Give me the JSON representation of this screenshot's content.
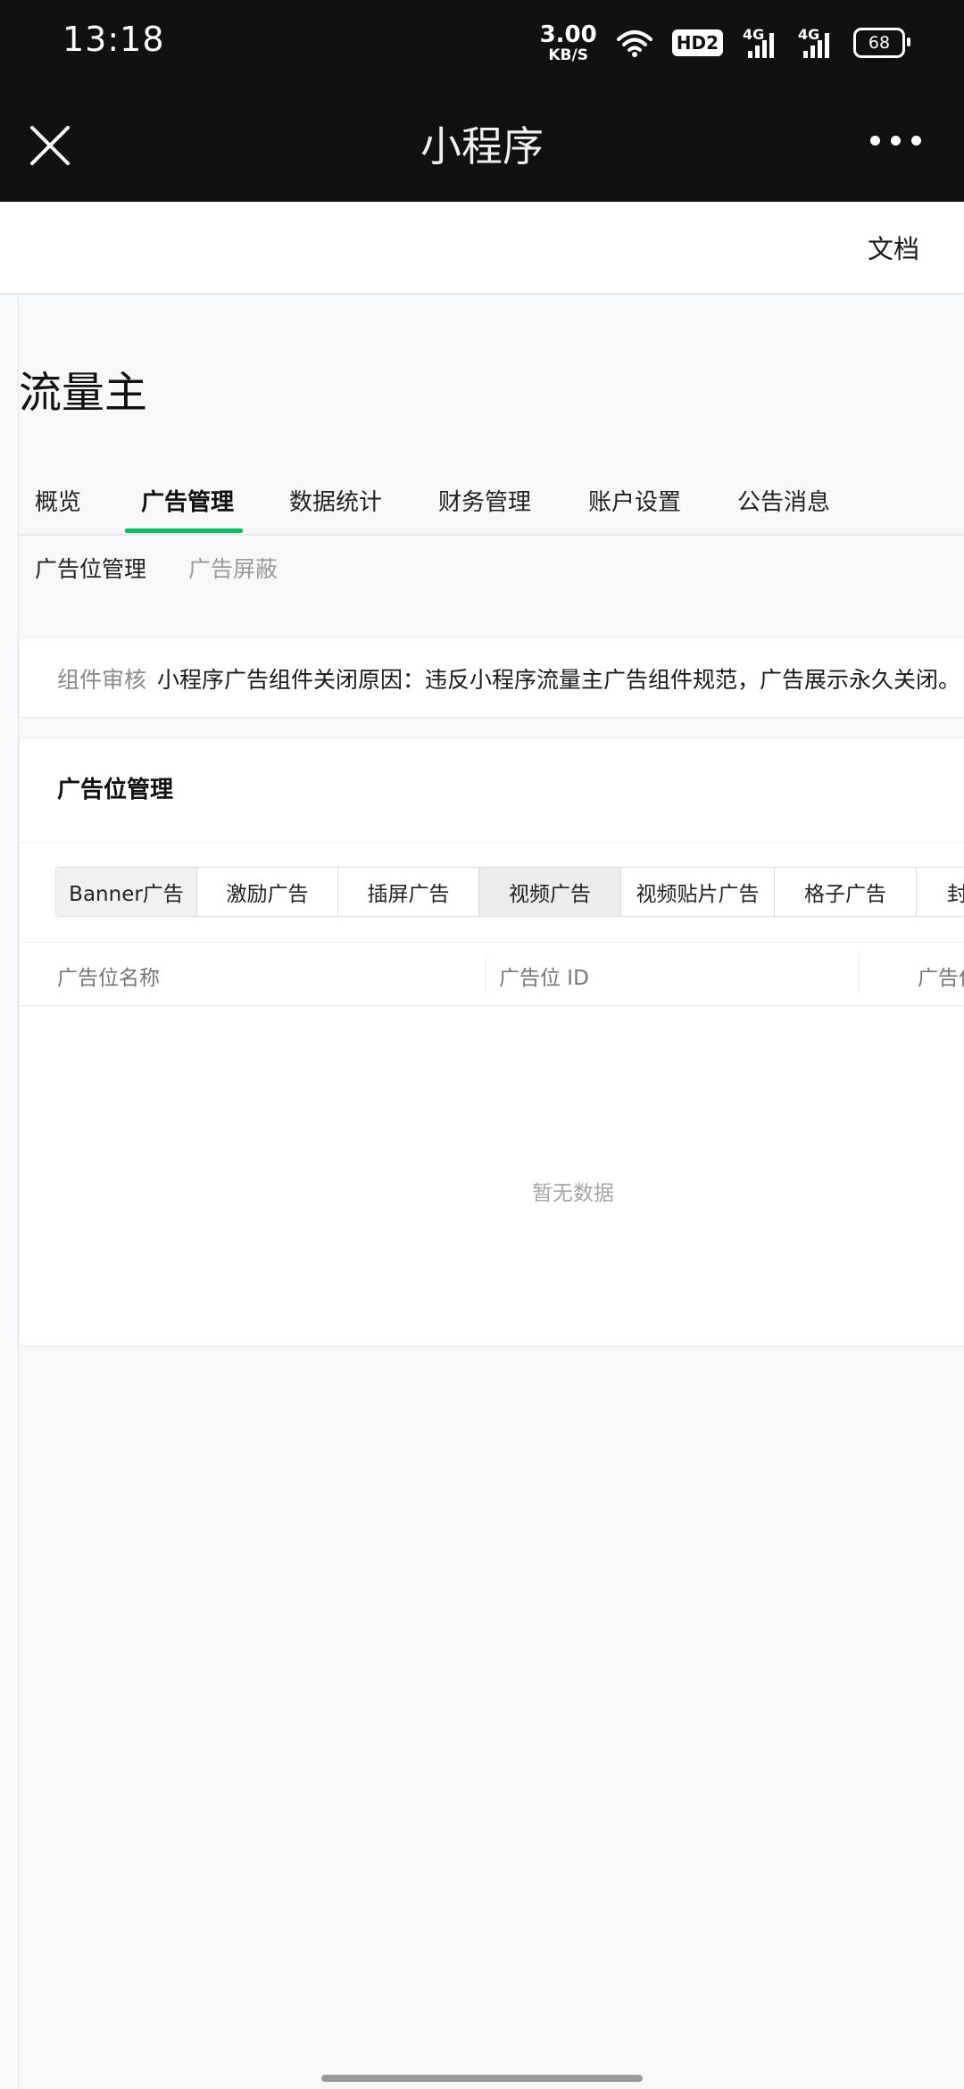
{
  "status_bar": {
    "time": "13:18",
    "net_speed_value": "3.00",
    "net_speed_unit": "KB/S",
    "hd_label": "HD2",
    "signal1_label": "4G",
    "signal2_label": "4G",
    "battery_level": "68"
  },
  "nav": {
    "title": "小程序",
    "close_icon": "close-icon",
    "more_icon": "more-dots-icon"
  },
  "header": {
    "doc_link": "文档"
  },
  "page": {
    "heading": "流量主",
    "tabs": [
      {
        "label": "概览"
      },
      {
        "label": "广告管理"
      },
      {
        "label": "数据统计"
      },
      {
        "label": "财务管理"
      },
      {
        "label": "账户设置"
      },
      {
        "label": "公告消息"
      }
    ],
    "active_tab": "广告管理",
    "subtabs": [
      {
        "label": "广告位管理"
      },
      {
        "label": "广告屏蔽"
      }
    ]
  },
  "notice": {
    "label": "组件审核",
    "text": "小程序广告组件关闭原因：违反小程序流量主广告组件规范，广告展示永久关闭。"
  },
  "card": {
    "title": "广告位管理",
    "ad_types": [
      {
        "label": "Banner广告"
      },
      {
        "label": "激励广告"
      },
      {
        "label": "插屏广告"
      },
      {
        "label": "视频广告"
      },
      {
        "label": "视频贴片广告"
      },
      {
        "label": "格子广告"
      },
      {
        "label": "封"
      }
    ],
    "selected_ad_type": "Banner广告",
    "columns": [
      {
        "label": "广告位名称"
      },
      {
        "label": "广告位 ID"
      },
      {
        "label": "广告位"
      }
    ],
    "empty_text": "暂无数据"
  },
  "colors": {
    "accent": "#07c160",
    "nav_bg": "#111111",
    "page_bg": "#f7f8fa"
  }
}
